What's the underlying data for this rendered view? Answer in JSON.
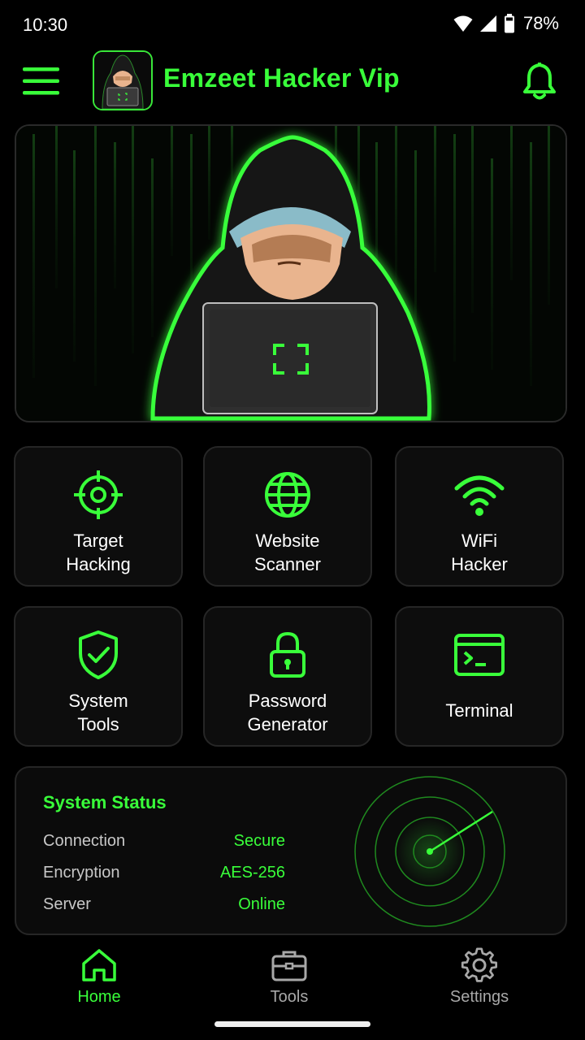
{
  "status_bar": {
    "time": "10:30",
    "battery": "78%",
    "icons": [
      "wifi-icon",
      "signal-icon",
      "battery-icon"
    ]
  },
  "header": {
    "title": "Emzeet Hacker Vip",
    "menu_icon": "hamburger-menu-icon",
    "notification_icon": "bell-icon"
  },
  "tools": [
    {
      "line1": "Target",
      "line2": "Hacking",
      "icon": "target-icon"
    },
    {
      "line1": "Website",
      "line2": "Scanner",
      "icon": "globe-icon"
    },
    {
      "line1": "WiFi",
      "line2": "Hacker",
      "icon": "wifi-icon"
    },
    {
      "line1": "System",
      "line2": "Tools",
      "icon": "shield-check-icon"
    },
    {
      "line1": "Password",
      "line2": "Generator",
      "icon": "lock-icon"
    },
    {
      "line1": "Terminal",
      "line2": "",
      "icon": "terminal-icon"
    }
  ],
  "system_status": {
    "title": "System Status",
    "rows": [
      {
        "label": "Connection",
        "value": "Secure"
      },
      {
        "label": "Encryption",
        "value": "AES-256"
      },
      {
        "label": "Server",
        "value": "Online"
      }
    ]
  },
  "nav": [
    {
      "label": "Home",
      "icon": "home-icon",
      "active": true
    },
    {
      "label": "Tools",
      "icon": "briefcase-icon",
      "active": false
    },
    {
      "label": "Settings",
      "icon": "gear-icon",
      "active": false
    }
  ],
  "colors": {
    "accent": "#39ff3a",
    "background": "#000000",
    "card": "#0d0d0d",
    "card_border": "#262626"
  }
}
